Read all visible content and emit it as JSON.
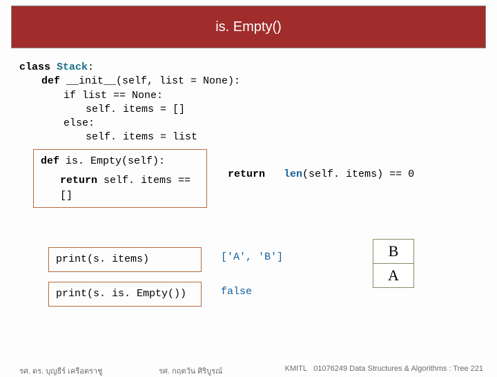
{
  "title": "is. Empty()",
  "code": {
    "l1_a": "class ",
    "l1_b": "Stack",
    "l1_c": ":",
    "l2_a": "def ",
    "l2_b": "__init__(self, list = None):",
    "l3": "if list == None:",
    "l4": "self. items = []",
    "l5": "else:",
    "l6": "self. items = list"
  },
  "method": {
    "def_a": "def ",
    "def_b": "is. Empty(self):",
    "ret_a": "return ",
    "ret_b": "self. items == []"
  },
  "alt": {
    "ret": "return",
    "len": "len",
    "rest": "(self. items) == 0"
  },
  "prints": {
    "p1": "print(s. items)",
    "p2": "print(s. is. Empty())"
  },
  "outputs": {
    "o1": "['A', 'B']",
    "o2": "false"
  },
  "stack": {
    "top": "B",
    "bot": "A"
  },
  "footer": {
    "left": "รศ. ดร. บุญธีร์     เครือตราชู",
    "mid": "รศ. กฤตวัน  ศิริบูรณ์",
    "right_inst": "KMITL",
    "right_course": "01076249 Data Structures & Algorithms : Tree 221"
  }
}
